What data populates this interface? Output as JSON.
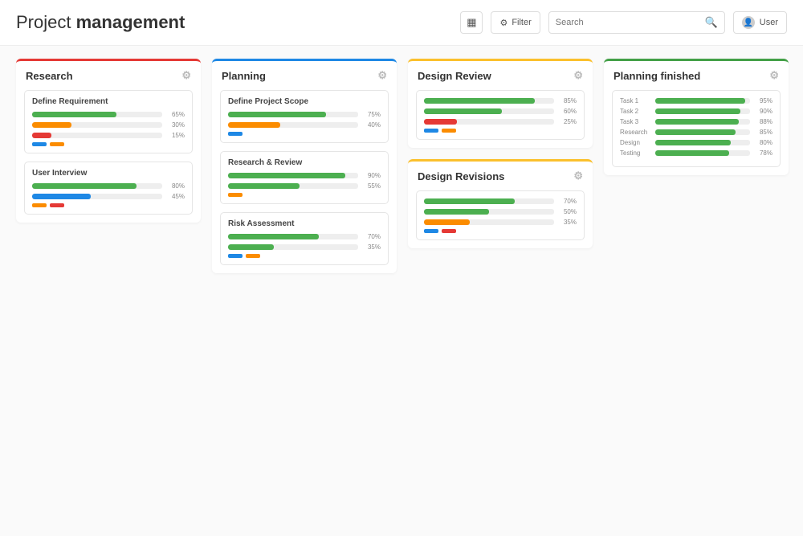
{
  "header": {
    "title_light": "Project",
    "title_bold": "management",
    "filter_label": "Filter",
    "search_placeholder": "Search",
    "user_label": "User"
  },
  "columns": [
    {
      "title": "Research",
      "accent": "red",
      "cards": [
        {
          "title": "Define Requirement",
          "bars": [
            {
              "label": "",
              "pct": 65,
              "color": "green"
            },
            {
              "label": "",
              "pct": 30,
              "color": "orange"
            },
            {
              "label": "",
              "pct": 15,
              "color": "red"
            }
          ],
          "tags": [
            "blue",
            "orange"
          ]
        },
        {
          "title": "User Interview",
          "bars": [
            {
              "label": "",
              "pct": 80,
              "color": "green"
            },
            {
              "label": "",
              "pct": 45,
              "color": "blue"
            }
          ],
          "tags": [
            "orange",
            "red"
          ]
        }
      ]
    },
    {
      "title": "Planning",
      "accent": "blue",
      "cards": [
        {
          "title": "Define Project Scope",
          "bars": [
            {
              "label": "",
              "pct": 75,
              "color": "green"
            },
            {
              "label": "",
              "pct": 40,
              "color": "orange"
            }
          ],
          "tags": [
            "blue"
          ]
        },
        {
          "title": "Research & Review",
          "bars": [
            {
              "label": "",
              "pct": 90,
              "color": "green"
            },
            {
              "label": "",
              "pct": 55,
              "color": "green"
            }
          ],
          "tags": [
            "orange"
          ]
        },
        {
          "title": "Risk Assessment",
          "bars": [
            {
              "label": "",
              "pct": 70,
              "color": "green"
            },
            {
              "label": "",
              "pct": 35,
              "color": "green"
            }
          ],
          "tags": [
            "blue",
            "orange"
          ]
        }
      ]
    },
    {
      "title": "Design Review",
      "accent": "yellow",
      "cards": [
        {
          "title": "",
          "bars": [
            {
              "label": "",
              "pct": 85,
              "color": "green"
            },
            {
              "label": "",
              "pct": 60,
              "color": "green"
            },
            {
              "label": "",
              "pct": 25,
              "color": "red"
            }
          ],
          "tags": [
            "blue",
            "orange"
          ]
        }
      ]
    },
    {
      "title": "Design Revisions",
      "accent": "yellow",
      "cards": [
        {
          "title": "",
          "bars": [
            {
              "label": "",
              "pct": 70,
              "color": "green"
            },
            {
              "label": "",
              "pct": 50,
              "color": "green"
            },
            {
              "label": "",
              "pct": 35,
              "color": "orange"
            }
          ],
          "tags": [
            "blue",
            "red"
          ]
        }
      ]
    },
    {
      "title": "Planning finished",
      "accent": "green",
      "cards": [
        {
          "title": "",
          "bars": [
            {
              "label": "Task 1",
              "pct": 95,
              "color": "green"
            },
            {
              "label": "Task 2",
              "pct": 90,
              "color": "green"
            },
            {
              "label": "Task 3",
              "pct": 88,
              "color": "green"
            },
            {
              "label": "Research",
              "pct": 85,
              "color": "green"
            },
            {
              "label": "Design",
              "pct": 80,
              "color": "green"
            },
            {
              "label": "Testing",
              "pct": 78,
              "color": "green"
            }
          ],
          "tags": []
        }
      ]
    }
  ]
}
